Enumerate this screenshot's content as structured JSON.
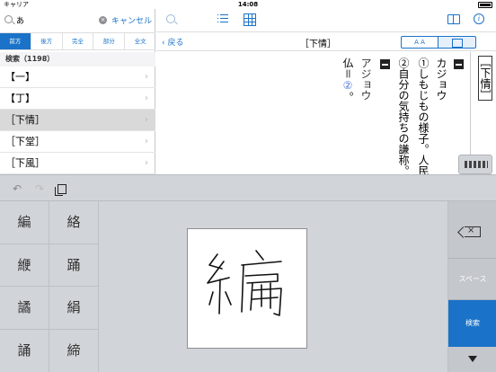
{
  "status_bar": {
    "carrier": "キャリア",
    "time": "14:08"
  },
  "search": {
    "value": "あ",
    "cancel_label": "キャンセル"
  },
  "search_modes": [
    "前方",
    "後方",
    "完全",
    "部分",
    "全文"
  ],
  "active_mode_index": 0,
  "results": {
    "header": "検索（1198）",
    "items": [
      "【一】",
      "【丁】",
      "［下情］",
      "［下堂］",
      "［下風］"
    ],
    "selected_index": 2
  },
  "nav": {
    "back_label": "戻る",
    "title": "［下情］",
    "font_button_label": "A A"
  },
  "entry": {
    "headword": "［下情］",
    "reading": "カジョウ",
    "sense1": "①しもじもの様子。人民",
    "sense2": "②自分の気持ちの謙称。",
    "kanji_reading": "アジョウ",
    "category": "仏＝",
    "category_num": "②",
    "category_end": "。"
  },
  "keyboard": {
    "candidates": [
      "編",
      "絡",
      "緶",
      "踊",
      "譎",
      "絹",
      "誦",
      "締"
    ],
    "space_label": "スペース",
    "search_label": "検索"
  },
  "colors": {
    "accent": "#1a73c9",
    "keyboard_bg": "#d1d4d8"
  }
}
